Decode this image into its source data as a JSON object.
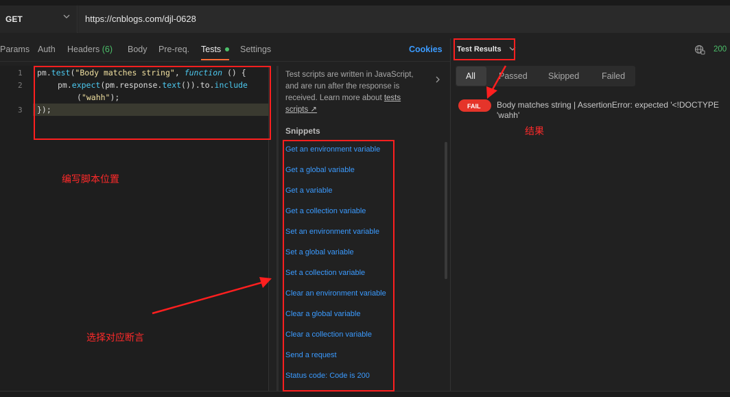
{
  "request": {
    "method": "GET",
    "url": "https://cnblogs.com/djl-0628"
  },
  "tabs": [
    {
      "label": "Params"
    },
    {
      "label": "Auth"
    },
    {
      "label": "Headers",
      "count": "(6)"
    },
    {
      "label": "Body"
    },
    {
      "label": "Pre-req."
    },
    {
      "label": "Tests"
    },
    {
      "label": "Settings"
    }
  ],
  "cookies_label": "Cookies",
  "editor": {
    "line_numbers": [
      "1",
      "2",
      "3"
    ],
    "line1": {
      "obj": "pm.",
      "fn": "test",
      "open": "(",
      "str": "\"Body matches string\"",
      "sep": ", ",
      "kw": "function",
      "rest": " () {"
    },
    "line2": {
      "obj": "pm.",
      "fn": "expect",
      "mid": "(pm.response.",
      "fn2": "text",
      "mid2": "()).to.",
      "fn3": "include"
    },
    "line2b": {
      "open": "(",
      "str": "\"wahh\"",
      "close": ");"
    },
    "line3": "});"
  },
  "snippets": {
    "intro_text": "Test scripts are written in JavaScript, and are run after the response is received. Learn more about",
    "intro_link": "tests scripts ↗",
    "title": "Snippets",
    "items": [
      "Get an environment variable",
      "Get a global variable",
      "Get a variable",
      "Get a collection variable",
      "Set an environment variable",
      "Set a global variable",
      "Set a collection variable",
      "Clear an environment variable",
      "Clear a global variable",
      "Clear a collection variable",
      "Send a request",
      "Status code: Code is 200"
    ]
  },
  "results": {
    "title": "Test Results",
    "status": "200",
    "filters": [
      "All",
      "Passed",
      "Skipped",
      "Failed"
    ],
    "fail_badge": "FAIL",
    "message_line1": "Body matches string | AssertionError: expected '<!DOCTYPE",
    "message_line2": "'wahh'"
  },
  "annotations": {
    "editor_note": "编写脚本位置",
    "result_note": "结果",
    "snippet_note": "选择对应断言",
    "color": "#ff1f1f"
  },
  "colors": {
    "accent": "#ff6c37",
    "link": "#3b9bff",
    "success": "#4cbf6a",
    "fail": "#e5342a"
  }
}
